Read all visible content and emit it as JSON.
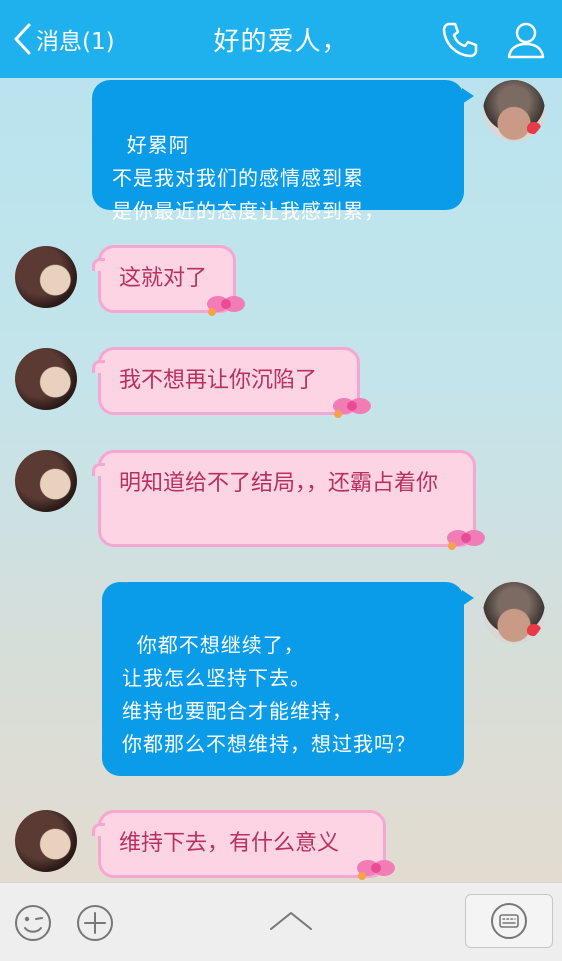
{
  "header": {
    "back_label": "消息(1)",
    "title": "好的爱人，"
  },
  "messages": [
    {
      "side": "out",
      "text": "好累阿\n不是我对我们的感情感到累\n是你最近的态度让我感到累，"
    },
    {
      "side": "in",
      "text": "这就对了"
    },
    {
      "side": "in",
      "text": "我不想再让你沉陷了"
    },
    {
      "side": "in",
      "text": "明知道给不了结局，，还霸占着你"
    },
    {
      "side": "out",
      "text": "你都不想继续了，\n让我怎么坚持下去。\n维持也要配合才能维持，\n你都那么不想维持，想过我吗？"
    },
    {
      "side": "in",
      "text": "维持下去，有什么意义"
    }
  ],
  "colors": {
    "header_bg": "#1fb1ee",
    "outgoing_bubble": "#0a9ce8",
    "incoming_bubble": "#fdd4e3",
    "incoming_border": "#f5a7d2",
    "incoming_text": "#b7305f"
  }
}
